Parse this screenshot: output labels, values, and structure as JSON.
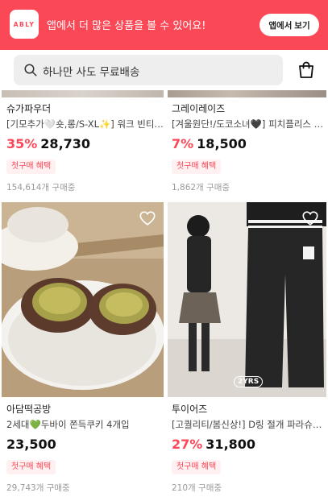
{
  "banner": {
    "logo_text": "ABLY",
    "message": "앱에서 더 많은 상품을 볼 수 있어요!",
    "open_app_label": "앱에서 보기",
    "color": "#fb4857"
  },
  "search": {
    "placeholder": "하나만 사도 무료배송",
    "icon": "search-icon"
  },
  "cart": {
    "icon": "shopping-bag-icon"
  },
  "products": [
    {
      "brand": "슈가파우더",
      "title": "[기모추가🤍숏,롱/S-XL✨] 워크 빈티지 와이드 카고 팬츠",
      "discount": "35%",
      "price": "28,730",
      "badge": "첫구매 혜택",
      "purchases": "154,614개 구매중"
    },
    {
      "brand": "그레이레이즈",
      "title": "[겨울원단!/도코소녀🖤] 피치플리스 후드 집업",
      "discount": "7%",
      "price": "18,500",
      "badge": "첫구매 혜택",
      "purchases": "1,862개 구매중"
    },
    {
      "brand": "아담떡공방",
      "title": "2세대💚두바이 쫀득쿠키 4개입",
      "discount": "",
      "price": "23,500",
      "badge": "첫구매 혜택",
      "purchases": "29,743개 구매중",
      "favorite_icon": "heart-icon"
    },
    {
      "brand": "투이어즈",
      "title": "[고퀄리티/봄신상!] D링 절개 파라슈트 와이드 팬츠",
      "discount": "27%",
      "price": "31,800",
      "badge": "첫구매 혜택",
      "purchases": "210개 구매중",
      "favorite_icon": "heart-icon",
      "image_tag": "2YRS"
    }
  ],
  "colors": {
    "accent": "#fb4857",
    "badge_bg": "#fff0f1",
    "muted_text": "#9a9a9a"
  }
}
